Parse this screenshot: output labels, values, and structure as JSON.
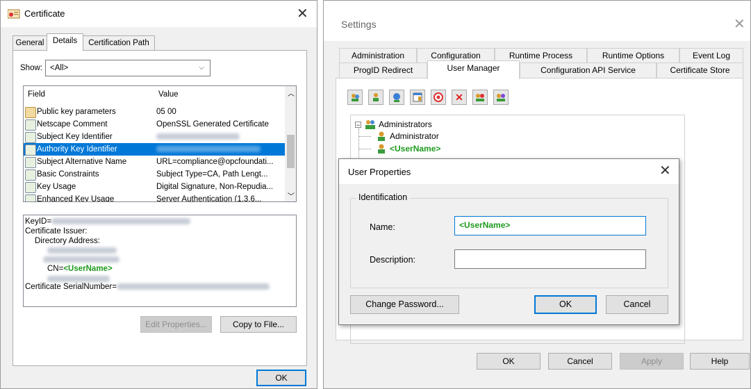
{
  "certificate": {
    "title": "Certificate",
    "close": "✕",
    "tabs": [
      "General",
      "Details",
      "Certification Path"
    ],
    "show_label": "Show:",
    "show_value": "<All>",
    "columns": [
      "Field",
      "Value"
    ],
    "rows": [
      {
        "field": "Public key parameters",
        "value": "05 00"
      },
      {
        "field": "Netscape Comment",
        "value": "OpenSSL Generated Certificate"
      },
      {
        "field": "Subject Key Identifier",
        "value": ""
      },
      {
        "field": "Authority Key Identifier",
        "value": ""
      },
      {
        "field": "Subject Alternative Name",
        "value": "URL=compliance@opcfoundati..."
      },
      {
        "field": "Basic Constraints",
        "value": "Subject Type=CA, Path Lengt..."
      },
      {
        "field": "Key Usage",
        "value": "Digital Signature, Non-Repudia..."
      },
      {
        "field": "Enhanced Key Usage",
        "value": "Server Authentication (1.3.6..."
      }
    ],
    "details": {
      "keyid": "KeyID=",
      "issuer": "Certificate Issuer:",
      "dir": "Directory Address:",
      "cn_prefix": "CN=",
      "cn_value": "<UserName>",
      "serial": "Certificate SerialNumber="
    },
    "edit_properties": "Edit Properties...",
    "copy_to_file": "Copy to File...",
    "ok": "OK"
  },
  "settings": {
    "title": "Settings",
    "close": "✕",
    "tabs_row1": [
      "Administration",
      "Configuration",
      "Runtime Process",
      "Runtime Options",
      "Event Log"
    ],
    "tabs_row2": [
      "ProgID Redirect",
      "User Manager",
      "Configuration API Service",
      "Certificate Store"
    ],
    "tree": {
      "group": "Administrators",
      "user1": "Administrator",
      "user2": "<UserName>"
    },
    "buttons": {
      "ok": "OK",
      "cancel": "Cancel",
      "apply": "Apply",
      "help": "Help"
    }
  },
  "user_properties": {
    "title": "User Properties",
    "close": "✕",
    "group": "Identification",
    "name_label": "Name:",
    "name_value": "<UserName>",
    "description_label": "Description:",
    "description_value": "",
    "change_password": "Change Password...",
    "ok": "OK",
    "cancel": "Cancel"
  },
  "colors": {
    "accent": "#0078d7",
    "highlight_text": "#1e9a1e"
  }
}
